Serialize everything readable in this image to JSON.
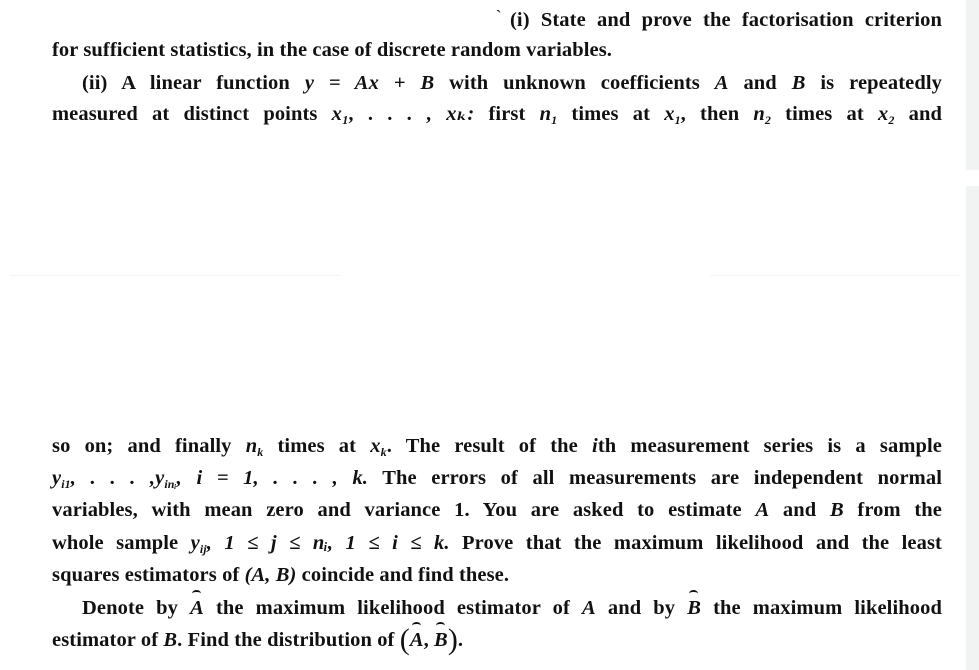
{
  "document": {
    "part_i": {
      "marker": "`",
      "line1": "(i) State and prove the factorisation criterion",
      "line2": "for sufficient statistics, in the case of discrete random variables."
    },
    "part_ii": {
      "line3": {
        "pre": "(ii) A linear function",
        "eq": "y = Ax + B",
        "mid1": "with unknown coefficients",
        "A": "A",
        "and": "and",
        "B": "B",
        "post": "is repeatedly"
      },
      "line4": {
        "pre": "measured at distinct points",
        "points": "x₁, . . . , xₖ:",
        "t1": "first",
        "n1": "n",
        "n1_sub": "1",
        "t2": "times at",
        "x1": "x",
        "x1_sub": "1",
        "t3": ", then",
        "n2": "n",
        "n2_sub": "2",
        "t4": "times at",
        "x2": "x",
        "x2_sub": "2",
        "t5": "and"
      },
      "line5": {
        "pre": "so on; and finally",
        "nk": "n",
        "nk_sub": "k",
        "t1": "times at",
        "xk": "x",
        "xk_sub": "k",
        "t2": ". The result of the",
        "ith": "i",
        "t3": "th measurement series is a sample"
      },
      "line6": {
        "sample": "y",
        "sample_sub1": "i1",
        "dots": ", . . . ,",
        "sample2": "y",
        "sample_sub2": "inᵢ",
        "range": ",  i = 1, . . . , k.",
        "post": "The errors of all measurements are independent normal"
      },
      "line7": "variables, with mean zero and variance 1. You are asked to estimate",
      "line7_A": "A",
      "line7_and": "and",
      "line7_B": "B",
      "line7_post": "from the",
      "line8": {
        "pre": "whole sample",
        "y": "y",
        "y_sub": "ij",
        "cond": ",  1 ≤ j ≤ nᵢ,  1 ≤ i ≤ k.",
        "post": "Prove that the maximum likelihood and the least"
      },
      "line9": {
        "pre": "squares estimators of",
        "pair": "(A, B)",
        "post": "coincide and find these."
      },
      "line10": {
        "pre": "Denote by",
        "Ahat": "A",
        "mid": "the maximum likelihood estimator of",
        "A": "A",
        "mid2": "and by",
        "Bhat": "B",
        "post": "the maximum likelihood"
      },
      "line11": {
        "pre": "estimator of",
        "B": "B",
        "mid": ". Find the distribution of",
        "open": "(",
        "Ahat": "A",
        "comma": ", ",
        "Bhat": "B",
        "close": ")",
        "end": "."
      }
    }
  }
}
